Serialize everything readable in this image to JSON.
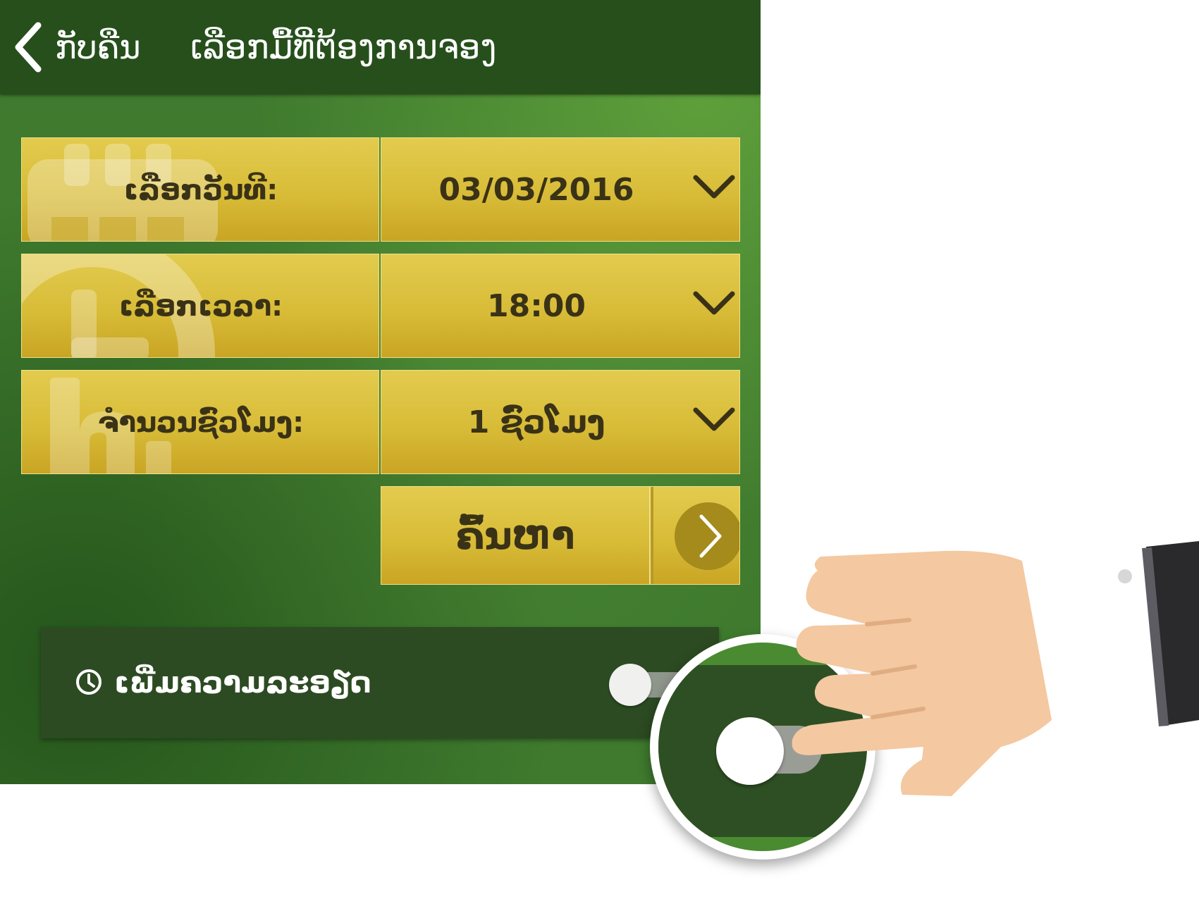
{
  "header": {
    "back_label": "ກັບຄືນ",
    "title": "ເລືອກມື້ທີ່ຕ້ອງການຈອງ"
  },
  "form": {
    "date": {
      "label": "ເລືອກວັນທີ:",
      "value": "03/03/2016",
      "icon": "calendar-icon"
    },
    "time": {
      "label": "ເລືອກເວລາ:",
      "value": "18:00",
      "icon": "clock-icon"
    },
    "hours": {
      "label": "ຈຳນວນຊົ່ວໂມງ:",
      "value": "1 ຊົ່ວໂມງ",
      "icon": "hours-icon"
    }
  },
  "search": {
    "label": "ຄົ້ນຫາ",
    "icon": "chevron-right-icon"
  },
  "details": {
    "label": "ເພີ່ມຄວາມລະອຽດ",
    "icon": "clock-icon",
    "toggle_on": false
  },
  "colors": {
    "header": "#264f1c",
    "background": "#3f7a2e",
    "gold": "#d8bc38",
    "dark_text": "#3a3216",
    "details_bar": "#2c4b22"
  }
}
